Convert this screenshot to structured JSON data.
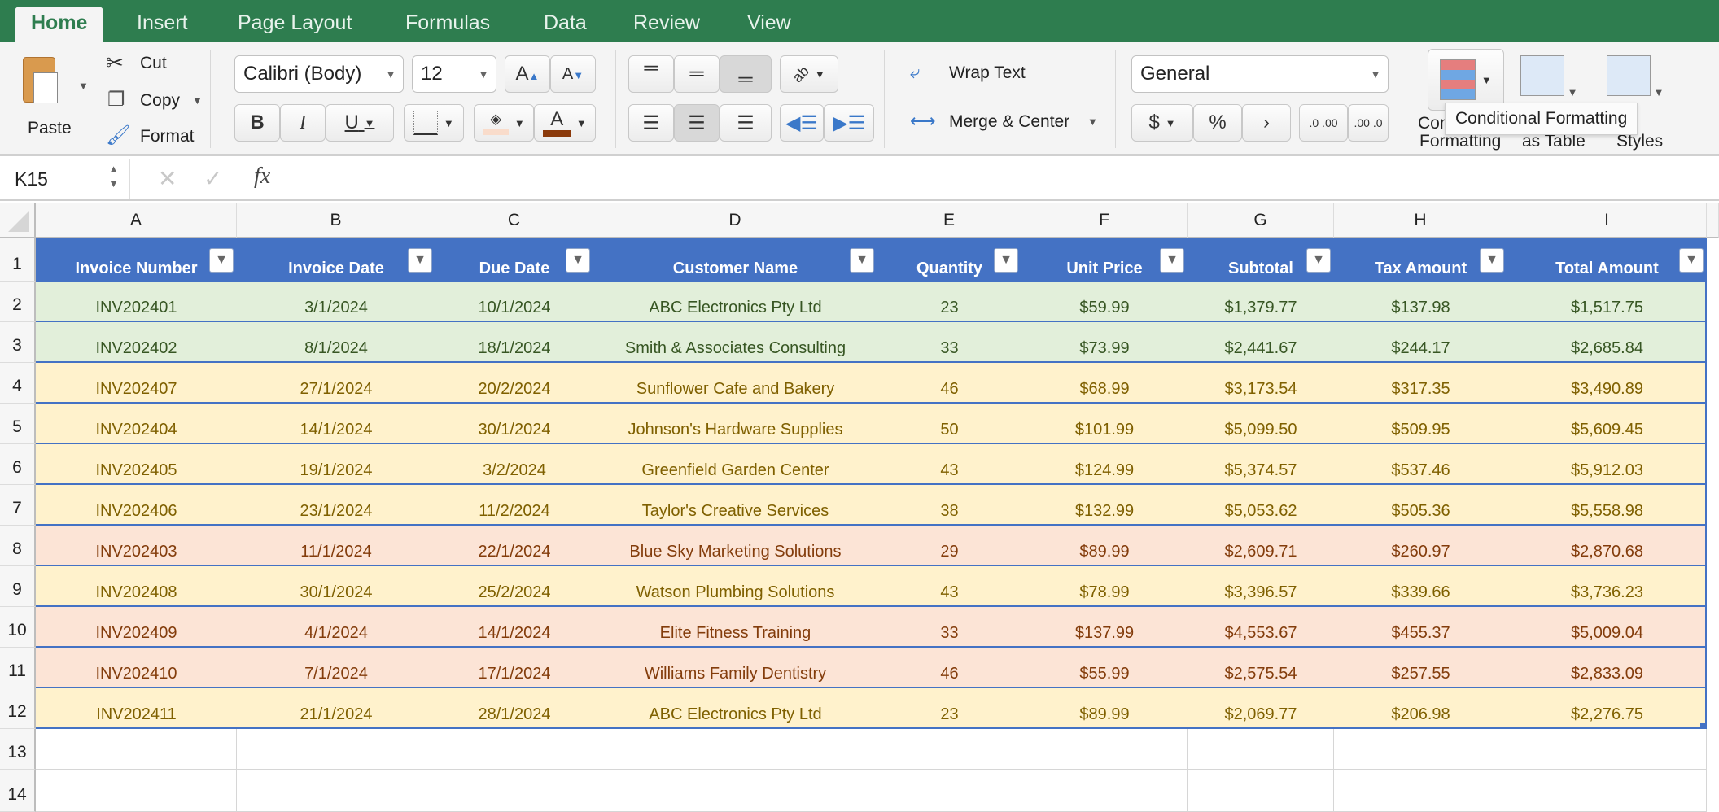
{
  "tabs": [
    {
      "label": "Home",
      "active": true
    },
    {
      "label": "Insert"
    },
    {
      "label": "Page Layout"
    },
    {
      "label": "Formulas"
    },
    {
      "label": "Data"
    },
    {
      "label": "Review"
    },
    {
      "label": "View"
    }
  ],
  "clipboard": {
    "paste": "Paste",
    "cut": "Cut",
    "copy": "Copy",
    "format": "Format"
  },
  "font": {
    "name": "Calibri (Body)",
    "size": "12",
    "bold": "B",
    "italic": "I",
    "underline": "U",
    "fill_color": "#f9dccb",
    "font_color": "#8b3a0b"
  },
  "alignment": {
    "wrap_text": "Wrap Text",
    "merge_center": "Merge & Center"
  },
  "number": {
    "format": "General",
    "currency": "$",
    "percent": "%",
    "comma": "›",
    "increase_decimal": ".0 .00",
    "decrease_decimal": ".00 .0"
  },
  "styles": {
    "conditional_formatting": "Conditional Formatting",
    "conditional_formatting_short": "Con",
    "formatting_line2": "Formatting",
    "format_as_table": "as Table",
    "cell_styles": "Styles"
  },
  "tooltip": "Conditional Formatting",
  "formula_bar": {
    "name_box": "K15",
    "cancel": "✕",
    "enter": "✓",
    "fx": "fx",
    "value": ""
  },
  "columns": [
    "A",
    "B",
    "C",
    "D",
    "E",
    "F",
    "G",
    "H",
    "I"
  ],
  "rows": [
    "1",
    "2",
    "3",
    "4",
    "5",
    "6",
    "7",
    "8",
    "9",
    "10",
    "11",
    "12",
    "13",
    "14"
  ],
  "table": {
    "headers": [
      "Invoice Number",
      "Invoice Date",
      "Due Date",
      "Customer Name",
      "Quantity",
      "Unit Price",
      "Subtotal",
      "Tax Amount",
      "Total Amount"
    ],
    "header_color": "#4472c4",
    "status_colors": {
      "green": {
        "fill": "#e2efda",
        "text": "#375623"
      },
      "yellow": {
        "fill": "#fff2cc",
        "text": "#7f6000"
      },
      "red": {
        "fill": "#fce4d6",
        "text": "#833c0b"
      }
    },
    "rows": [
      {
        "status": "green",
        "cells": [
          "INV202401",
          "3/1/2024",
          "10/1/2024",
          "ABC Electronics Pty Ltd",
          "23",
          "$59.99",
          "$1,379.77",
          "$137.98",
          "$1,517.75"
        ]
      },
      {
        "status": "green",
        "cells": [
          "INV202402",
          "8/1/2024",
          "18/1/2024",
          "Smith & Associates Consulting",
          "33",
          "$73.99",
          "$2,441.67",
          "$244.17",
          "$2,685.84"
        ]
      },
      {
        "status": "yellow",
        "cells": [
          "INV202407",
          "27/1/2024",
          "20/2/2024",
          "Sunflower Cafe and Bakery",
          "46",
          "$68.99",
          "$3,173.54",
          "$317.35",
          "$3,490.89"
        ]
      },
      {
        "status": "yellow",
        "cells": [
          "INV202404",
          "14/1/2024",
          "30/1/2024",
          "Johnson's Hardware Supplies",
          "50",
          "$101.99",
          "$5,099.50",
          "$509.95",
          "$5,609.45"
        ]
      },
      {
        "status": "yellow",
        "cells": [
          "INV202405",
          "19/1/2024",
          "3/2/2024",
          "Greenfield Garden Center",
          "43",
          "$124.99",
          "$5,374.57",
          "$537.46",
          "$5,912.03"
        ]
      },
      {
        "status": "yellow",
        "cells": [
          "INV202406",
          "23/1/2024",
          "11/2/2024",
          "Taylor's Creative Services",
          "38",
          "$132.99",
          "$5,053.62",
          "$505.36",
          "$5,558.98"
        ]
      },
      {
        "status": "red",
        "cells": [
          "INV202403",
          "11/1/2024",
          "22/1/2024",
          "Blue Sky Marketing Solutions",
          "29",
          "$89.99",
          "$2,609.71",
          "$260.97",
          "$2,870.68"
        ]
      },
      {
        "status": "yellow",
        "cells": [
          "INV202408",
          "30/1/2024",
          "25/2/2024",
          "Watson Plumbing Solutions",
          "43",
          "$78.99",
          "$3,396.57",
          "$339.66",
          "$3,736.23"
        ]
      },
      {
        "status": "red",
        "cells": [
          "INV202409",
          "4/1/2024",
          "14/1/2024",
          "Elite Fitness Training",
          "33",
          "$137.99",
          "$4,553.67",
          "$455.37",
          "$5,009.04"
        ]
      },
      {
        "status": "red",
        "cells": [
          "INV202410",
          "7/1/2024",
          "17/1/2024",
          "Williams Family Dentistry",
          "46",
          "$55.99",
          "$2,575.54",
          "$257.55",
          "$2,833.09"
        ]
      },
      {
        "status": "yellow",
        "cells": [
          "INV202411",
          "21/1/2024",
          "28/1/2024",
          "ABC Electronics Pty Ltd",
          "23",
          "$89.99",
          "$2,069.77",
          "$206.98",
          "$2,276.75"
        ]
      }
    ]
  }
}
